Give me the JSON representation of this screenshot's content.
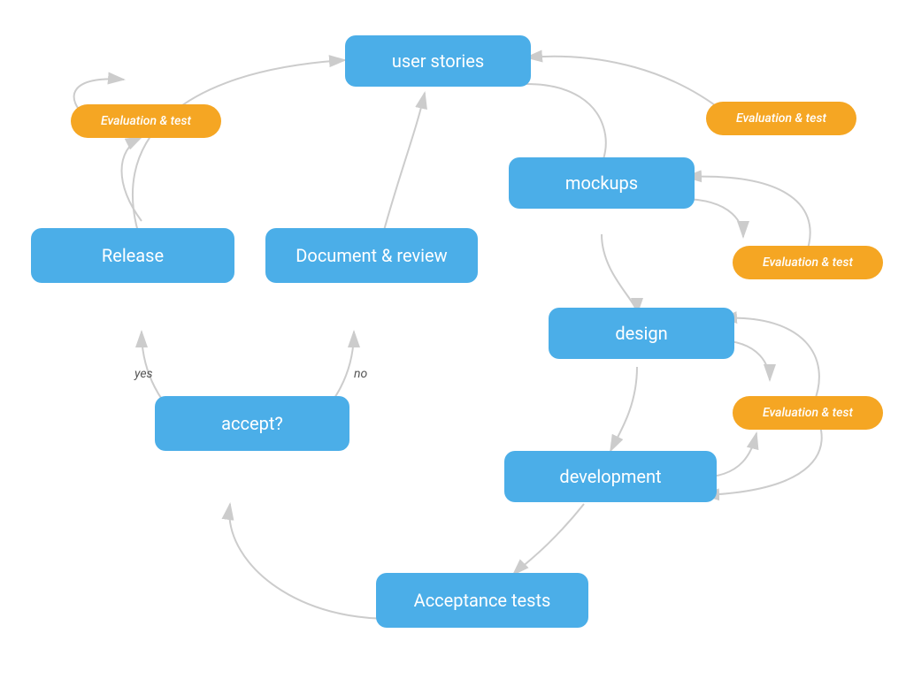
{
  "nodes": {
    "user_stories": {
      "label": "user stories"
    },
    "mockups": {
      "label": "mockups"
    },
    "design": {
      "label": "design"
    },
    "development": {
      "label": "development"
    },
    "acceptance_tests": {
      "label": "Acceptance tests"
    },
    "accept": {
      "label": "accept?"
    },
    "release": {
      "label": "Release"
    },
    "document_review": {
      "label": "Document & review"
    },
    "eval1": {
      "label": "Evaluation & test"
    },
    "eval2": {
      "label": "Evaluation & test"
    },
    "eval3": {
      "label": "Evaluation & test"
    },
    "eval4": {
      "label": "Evaluation & test"
    }
  },
  "labels": {
    "yes": "yes",
    "no": "no"
  }
}
